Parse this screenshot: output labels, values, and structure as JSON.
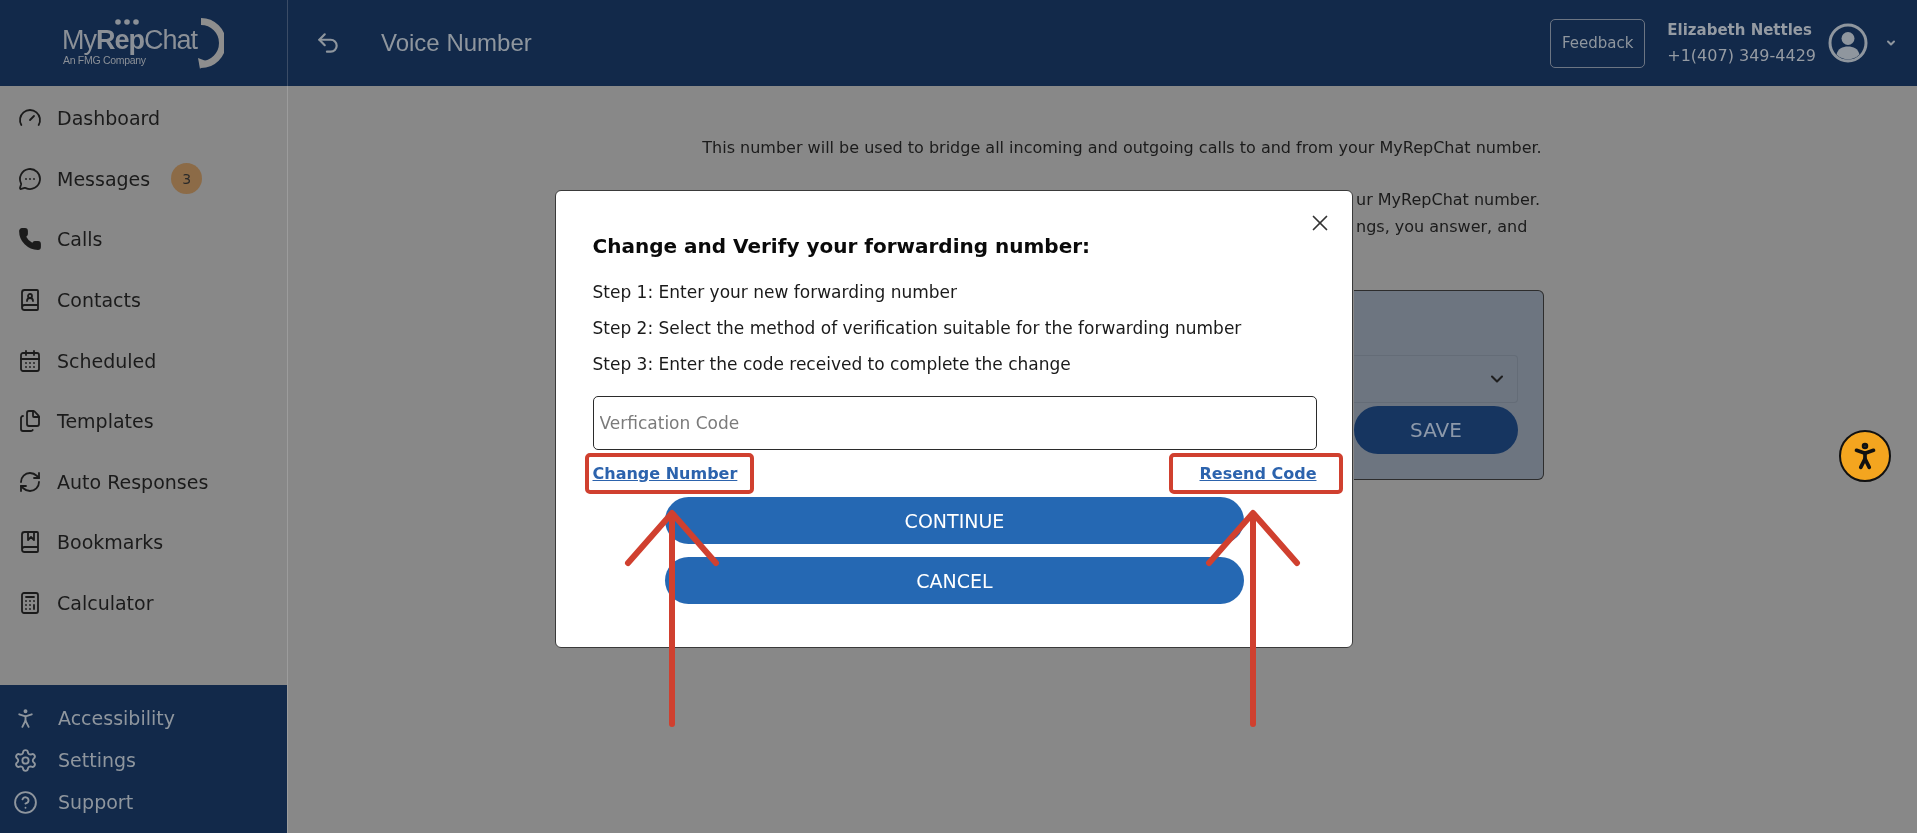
{
  "logo": {
    "wordmark": "My**Rep**Chat",
    "tagline": "An FMG Company"
  },
  "header": {
    "title": "Voice Number",
    "feedback_button": "Feedback",
    "user": {
      "name": "Elizabeth Nettles",
      "phone": "+1(407) 349-4429"
    }
  },
  "sidebar": {
    "items": [
      {
        "label": "Dashboard",
        "selected": false
      },
      {
        "label": "Messages",
        "selected": false,
        "badge": "3"
      },
      {
        "label": "Calls",
        "selected": false
      },
      {
        "label": "Contacts",
        "selected": false
      },
      {
        "label": "Scheduled",
        "selected": false
      },
      {
        "label": "Templates",
        "selected": false
      },
      {
        "label": "Auto Responses",
        "selected": false
      },
      {
        "label": "Bookmarks",
        "selected": false
      },
      {
        "label": "Calculator",
        "selected": false
      }
    ],
    "footer_items": [
      {
        "label": "Accessibility",
        "selected": false
      },
      {
        "label": "Settings",
        "selected": false
      },
      {
        "label": "Support",
        "selected": false
      }
    ]
  },
  "page": {
    "description": "This number will be used to bridge all incoming and outgoing calls to and from your MyRepChat number.",
    "covered_text_lines": [
      "ur MyRepChat number.",
      "ngs, you answer, and"
    ],
    "save_button": "SAVE"
  },
  "dialog": {
    "title": "Change and Verify your forwarding number:",
    "steps": [
      "Step 1: Enter your new forwarding number",
      "Step 2: Select the method of verification suitable for the forwarding number",
      "Step 3: Enter the code received to complete the change"
    ],
    "code_field": {
      "placeholder": "Verfication Code"
    },
    "links": [
      "Change Number",
      "Resend Code"
    ],
    "buttons": [
      "CONTINUE",
      "CANCEL"
    ]
  }
}
